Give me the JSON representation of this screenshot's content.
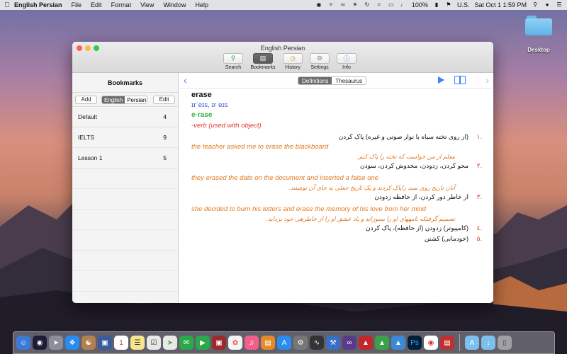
{
  "menubar": {
    "app_name": "English Persian",
    "menus": [
      "File",
      "Edit",
      "Format",
      "View",
      "Window",
      "Help"
    ],
    "battery": "100%",
    "input_source": "U.S.",
    "clock": "Sat Oct 1  1:59 PM"
  },
  "desktop": {
    "folder_label": "Desktop"
  },
  "window": {
    "title": "English Persian",
    "toolbar": {
      "search": "Search",
      "bookmarks": "Bookmarks",
      "history": "History",
      "settings": "Settings",
      "info": "Info"
    }
  },
  "sidebar": {
    "title": "Bookmarks",
    "add_label": "Add",
    "edit_label": "Edit",
    "seg_english": "English",
    "seg_persian": "Persian",
    "items": [
      {
        "name": "Default",
        "count": "4"
      },
      {
        "name": "IELTS",
        "count": "9"
      },
      {
        "name": "Lesson 1",
        "count": "5"
      }
    ]
  },
  "content": {
    "tab_definitions": "Definitions",
    "tab_thesaurus": "Thesaurus",
    "headword": "erase",
    "pronunciation": "ɪrˈeɪs, ɪrˈeɪs",
    "syllabified": "e·rase",
    "part_of_speech": "-verb (used with object)",
    "definitions": [
      {
        "num": "١.",
        "text": "(از روی تخته سیاه یا نوار صوتی و غیره) پاک کردن"
      },
      {
        "num": "٢.",
        "text": "محو کردن، زدودن، مخدوش کردن، سودن"
      },
      {
        "num": "٣.",
        "text": "از خاطر دور کردن، از حافظه زدودن"
      },
      {
        "num": "٤.",
        "text": "(کامپیوتر) زدودن (از حافظه)، پاک کردن"
      },
      {
        "num": "٥.",
        "text": "(خودمانی) کشتن"
      }
    ],
    "examples": [
      {
        "en": "the teacher asked me to erase the blackboard",
        "fa": "معلم از من خواست که تخته را پاک کنم."
      },
      {
        "en": "they erased the date on the document and inserted a false one",
        "fa": "آنان تاریخ روی سند راپاک کردند و یک تاریخ جعلی به جای آن نوشتند."
      },
      {
        "en": "she decided to burn his letters and erase the memory of his love from her mind",
        "fa": "تصمیم گرفتکه نامههای او را بسوزاند و یاد عشق او را از خاطرهی خود بزداید."
      }
    ]
  },
  "colors": {
    "accent": "#3b82f6",
    "pronunciation": "#2a55d4",
    "syllable": "#2db34a",
    "pos": "#e0392b",
    "example": "#e07a24"
  }
}
